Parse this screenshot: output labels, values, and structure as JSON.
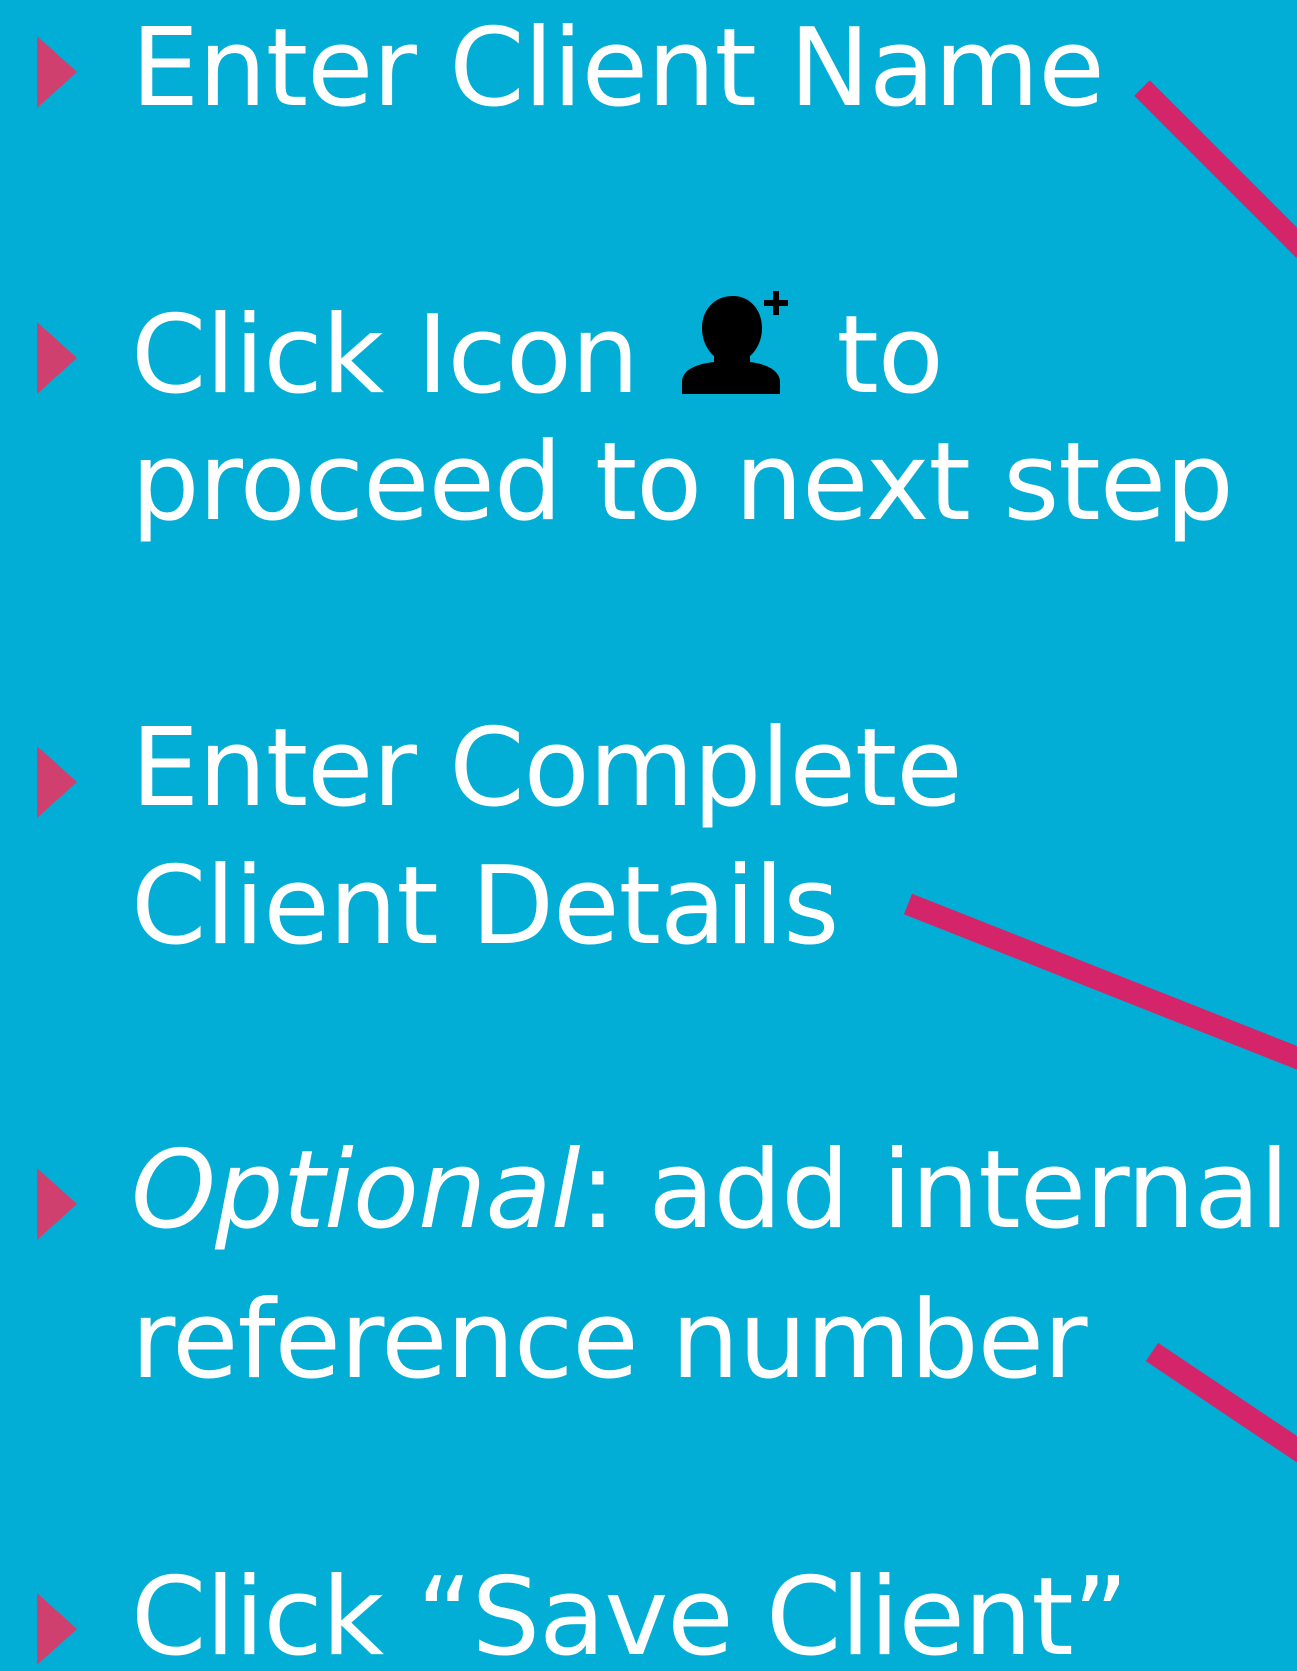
{
  "colors": {
    "background": "#02aed5",
    "text": "#ffffff",
    "bullet": "#cf406f",
    "pointer": "#d4246a",
    "icon": "#000000"
  },
  "steps": [
    {
      "text": "Enter Client Name"
    },
    {
      "line1_before": "Click Icon",
      "icon": "add-user-icon",
      "line1_after": "to",
      "line2": "proceed to next step"
    },
    {
      "line1": "Enter Complete",
      "line2": "Client Details"
    },
    {
      "line1_em": "Optional",
      "line1_rest": ": add internal",
      "line2": "reference number"
    },
    {
      "text": "Click “Save Client”"
    }
  ]
}
